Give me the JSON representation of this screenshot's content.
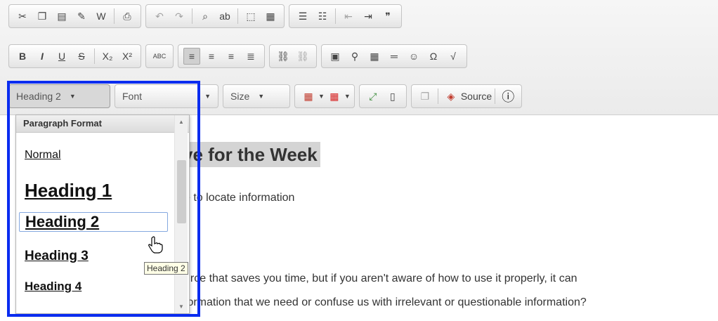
{
  "toolbar": {
    "row1_groups": [
      {
        "buttons": [
          {
            "name": "cut-icon",
            "glyph": "✂"
          },
          {
            "name": "copy-icon",
            "glyph": "❐"
          },
          {
            "name": "paste-icon",
            "glyph": "▤"
          },
          {
            "name": "paste-text-icon",
            "glyph": "✎"
          },
          {
            "name": "paste-word-icon",
            "glyph": "W"
          },
          {
            "sep": true
          },
          {
            "name": "print-icon",
            "glyph": "⎙"
          }
        ]
      },
      {
        "buttons": [
          {
            "name": "undo-icon",
            "glyph": "↶",
            "dim": true
          },
          {
            "name": "redo-icon",
            "glyph": "↷",
            "dim": true
          },
          {
            "sep": true
          },
          {
            "name": "find-icon",
            "glyph": "⌕"
          },
          {
            "name": "replace-icon",
            "glyph": "ab"
          },
          {
            "sep": true
          },
          {
            "name": "select-all-icon",
            "glyph": "⬚"
          },
          {
            "name": "html-icon",
            "glyph": "▦"
          }
        ]
      },
      {
        "buttons": [
          {
            "name": "numbered-list-icon",
            "glyph": "☰"
          },
          {
            "name": "bulleted-list-icon",
            "glyph": "☷"
          },
          {
            "sep": true
          },
          {
            "name": "outdent-icon",
            "glyph": "⇤",
            "dim": true
          },
          {
            "name": "indent-icon",
            "glyph": "⇥"
          },
          {
            "name": "blockquote-icon",
            "glyph": "❞"
          }
        ]
      }
    ],
    "row2_groups": [
      {
        "buttons": [
          {
            "name": "bold-icon",
            "glyph": "B"
          },
          {
            "name": "italic-icon",
            "glyph": "I"
          },
          {
            "name": "underline-icon",
            "glyph": "U"
          },
          {
            "name": "strikethrough-icon",
            "glyph": "S"
          },
          {
            "sep": true
          },
          {
            "name": "subscript-icon",
            "glyph": "X₂"
          },
          {
            "name": "superscript-icon",
            "glyph": "X²"
          }
        ]
      },
      {
        "buttons": [
          {
            "name": "spellcheck-icon",
            "glyph": "ABC"
          }
        ]
      },
      {
        "buttons": [
          {
            "name": "align-left-icon",
            "glyph": "≡",
            "active": true
          },
          {
            "name": "align-center-icon",
            "glyph": "≡"
          },
          {
            "name": "align-right-icon",
            "glyph": "≡"
          },
          {
            "name": "align-justify-icon",
            "glyph": "≣"
          }
        ]
      },
      {
        "buttons": [
          {
            "name": "link-icon",
            "glyph": "⛓"
          },
          {
            "name": "unlink-icon",
            "glyph": "⛓",
            "dim": true
          }
        ]
      },
      {
        "buttons": [
          {
            "name": "image-icon",
            "glyph": "▣"
          },
          {
            "name": "anchor-icon",
            "glyph": "⚲"
          },
          {
            "name": "table-icon",
            "glyph": "▦"
          },
          {
            "name": "horizontal-rule-icon",
            "glyph": "═"
          },
          {
            "name": "smiley-icon",
            "glyph": "☺"
          },
          {
            "name": "special-char-icon",
            "glyph": "Ω"
          },
          {
            "name": "math-icon",
            "glyph": "√"
          }
        ]
      }
    ],
    "format_combo": {
      "label": "Heading 2"
    },
    "font_combo": {
      "label": "Font"
    },
    "size_combo": {
      "label": "Size"
    },
    "source_label": "Source"
  },
  "dropdown": {
    "title": "Paragraph Format",
    "items": [
      {
        "label": "Normal",
        "size": 16,
        "weight": "normal"
      },
      {
        "label": "Heading 1",
        "size": 26,
        "weight": "bold"
      },
      {
        "label": "Heading 2",
        "size": 22,
        "weight": "bold"
      },
      {
        "label": "Heading 3",
        "size": 19,
        "weight": "bold"
      },
      {
        "label": "Heading 4",
        "size": 17,
        "weight": "bold"
      }
    ],
    "tooltip": "Heading 2"
  },
  "editor": {
    "heading": "ve for the Week",
    "line1": "e to locate information",
    "line2": "urce that saves you time, but if you aren't aware of how to use it properly, it can",
    "line3": "formation that we need or confuse us with irrelevant or questionable information?"
  },
  "colors": {
    "highlight": "#0a2cf0",
    "tooltip_bg": "#ffffe6"
  }
}
